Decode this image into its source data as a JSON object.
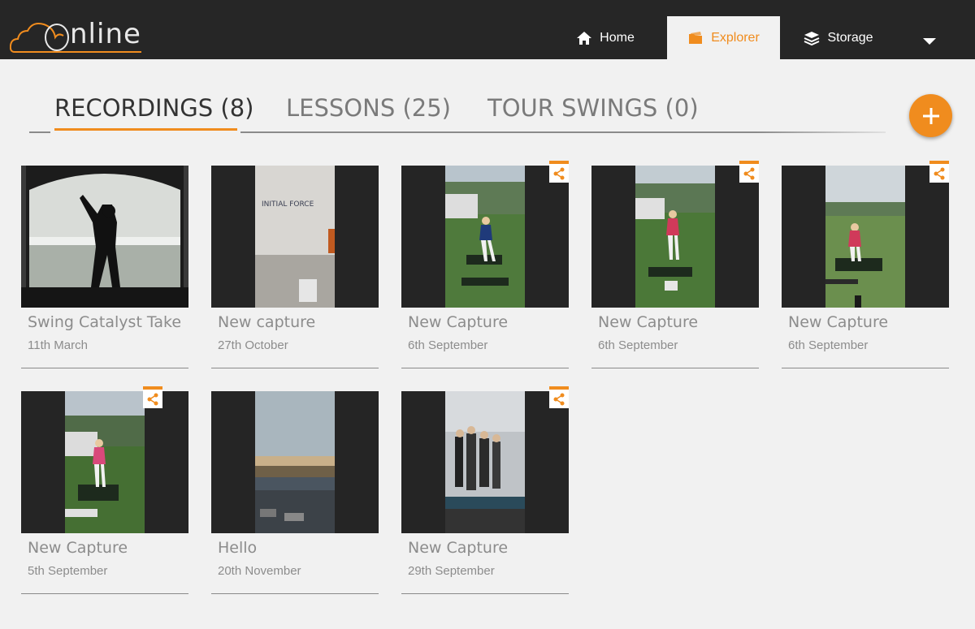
{
  "app": {
    "logo_text": "nline"
  },
  "nav": {
    "home": {
      "label": "Home",
      "icon": "home-icon"
    },
    "explorer": {
      "label": "Explorer",
      "icon": "folder-icon",
      "active": true
    },
    "storage": {
      "label": "Storage",
      "icon": "layers-icon"
    },
    "menu_icon": "chevron-down-icon"
  },
  "tabs": [
    {
      "label": "RECORDINGS (8)",
      "active": true
    },
    {
      "label": "LESSONS (25)",
      "active": false
    },
    {
      "label": "TOUR SWINGS (0)",
      "active": false
    }
  ],
  "add_button": {
    "icon": "plus-icon"
  },
  "colors": {
    "accent": "#f08c1e",
    "topbar": "#262626",
    "background": "#f1f1f1"
  },
  "recordings": [
    {
      "title": "Swing Catalyst Take",
      "date": "11th March",
      "shared": false,
      "thumb": "golfer silhouette indoor"
    },
    {
      "title": "New capture",
      "date": "27th October",
      "shared": false,
      "thumb": "office lobby"
    },
    {
      "title": "New Capture",
      "date": "6th September",
      "shared": true,
      "thumb": "driving range"
    },
    {
      "title": "New Capture",
      "date": "6th September",
      "shared": true,
      "thumb": "driving range"
    },
    {
      "title": "New Capture",
      "date": "6th September",
      "shared": true,
      "thumb": "driving range"
    },
    {
      "title": "New Capture",
      "date": "5th September",
      "shared": true,
      "thumb": "driving range"
    },
    {
      "title": "Hello",
      "date": "20th November",
      "shared": false,
      "thumb": "window view"
    },
    {
      "title": "New Capture",
      "date": "29th September",
      "shared": true,
      "thumb": "indoor stage"
    }
  ],
  "thumb_texts": {
    "sign": "INITIAL FORCE"
  }
}
